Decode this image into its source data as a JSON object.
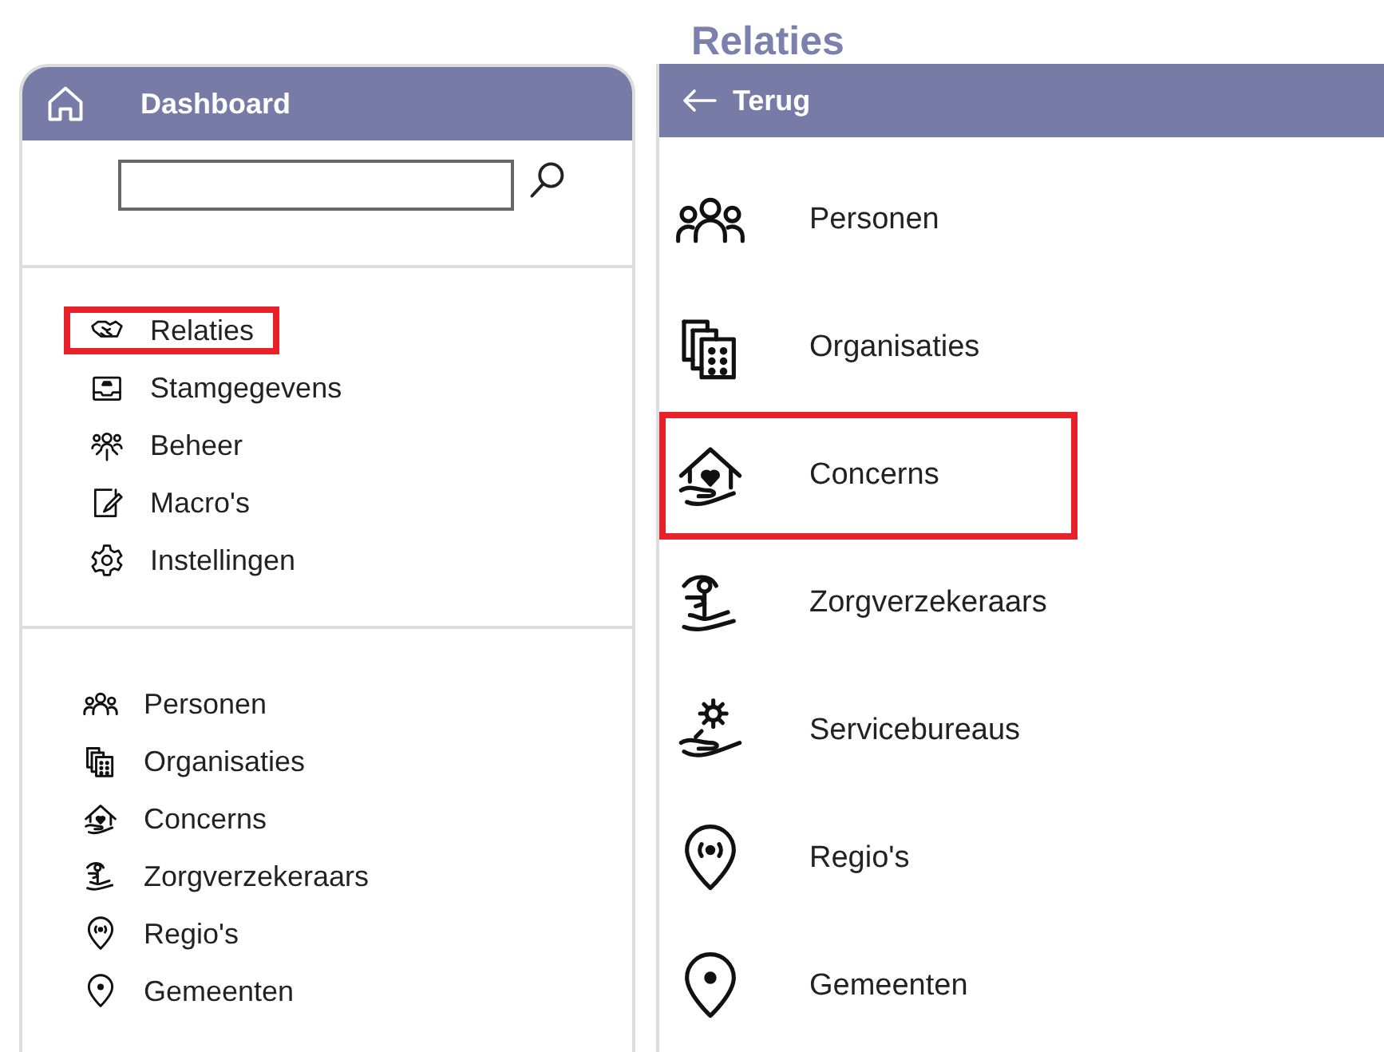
{
  "page_title": "Relaties",
  "dashboard": {
    "header": "Dashboard",
    "menu": [
      {
        "label": "Relaties",
        "highlighted": true
      },
      {
        "label": "Stamgegevens",
        "highlighted": false
      },
      {
        "label": "Beheer",
        "highlighted": false
      },
      {
        "label": "Macro's",
        "highlighted": false
      },
      {
        "label": "Instellingen",
        "highlighted": false
      }
    ],
    "relations": [
      {
        "label": "Personen"
      },
      {
        "label": "Organisaties"
      },
      {
        "label": "Concerns"
      },
      {
        "label": "Zorgverzekeraars"
      },
      {
        "label": "Regio's"
      },
      {
        "label": "Gemeenten"
      }
    ]
  },
  "relaties_panel": {
    "back": "Terug",
    "items": [
      {
        "label": "Personen",
        "highlighted": false
      },
      {
        "label": "Organisaties",
        "highlighted": false
      },
      {
        "label": "Concerns",
        "highlighted": true
      },
      {
        "label": "Zorgverzekeraars",
        "highlighted": false
      },
      {
        "label": "Servicebureaus",
        "highlighted": false
      },
      {
        "label": "Regio's",
        "highlighted": false
      },
      {
        "label": "Gemeenten",
        "highlighted": false
      }
    ]
  }
}
